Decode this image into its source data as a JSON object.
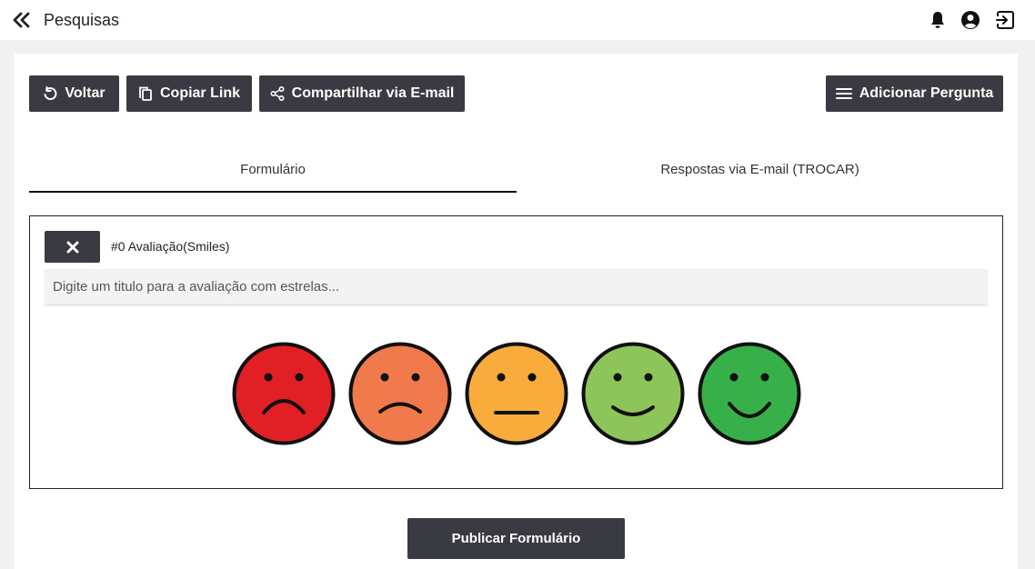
{
  "header": {
    "title": "Pesquisas"
  },
  "toolbar": {
    "voltar_label": "Voltar",
    "copiar_label": "Copiar Link",
    "compartilhar_label": "Compartilhar via E-mail",
    "adicionar_label": "Adicionar Pergunta"
  },
  "tabs": [
    {
      "label": "Formulário",
      "active": true
    },
    {
      "label": "Respostas via E-mail (TROCAR)",
      "active": false
    }
  ],
  "question": {
    "label": "#0 Avaliação(Smiles)",
    "placeholder": "Digite um titulo para a avaliação com estrelas...",
    "value": "",
    "smiles": [
      {
        "mood": "very-unhappy",
        "color": "#e02025"
      },
      {
        "mood": "unhappy",
        "color": "#f07a4c"
      },
      {
        "mood": "neutral",
        "color": "#f9ac3c"
      },
      {
        "mood": "happy",
        "color": "#8ec55a"
      },
      {
        "mood": "very-happy",
        "color": "#37b04a"
      }
    ]
  },
  "footer": {
    "publish_label": "Publicar Formulário"
  },
  "colors": {
    "button_bg": "#3a3a42",
    "page_bg": "#f1f1f1"
  }
}
